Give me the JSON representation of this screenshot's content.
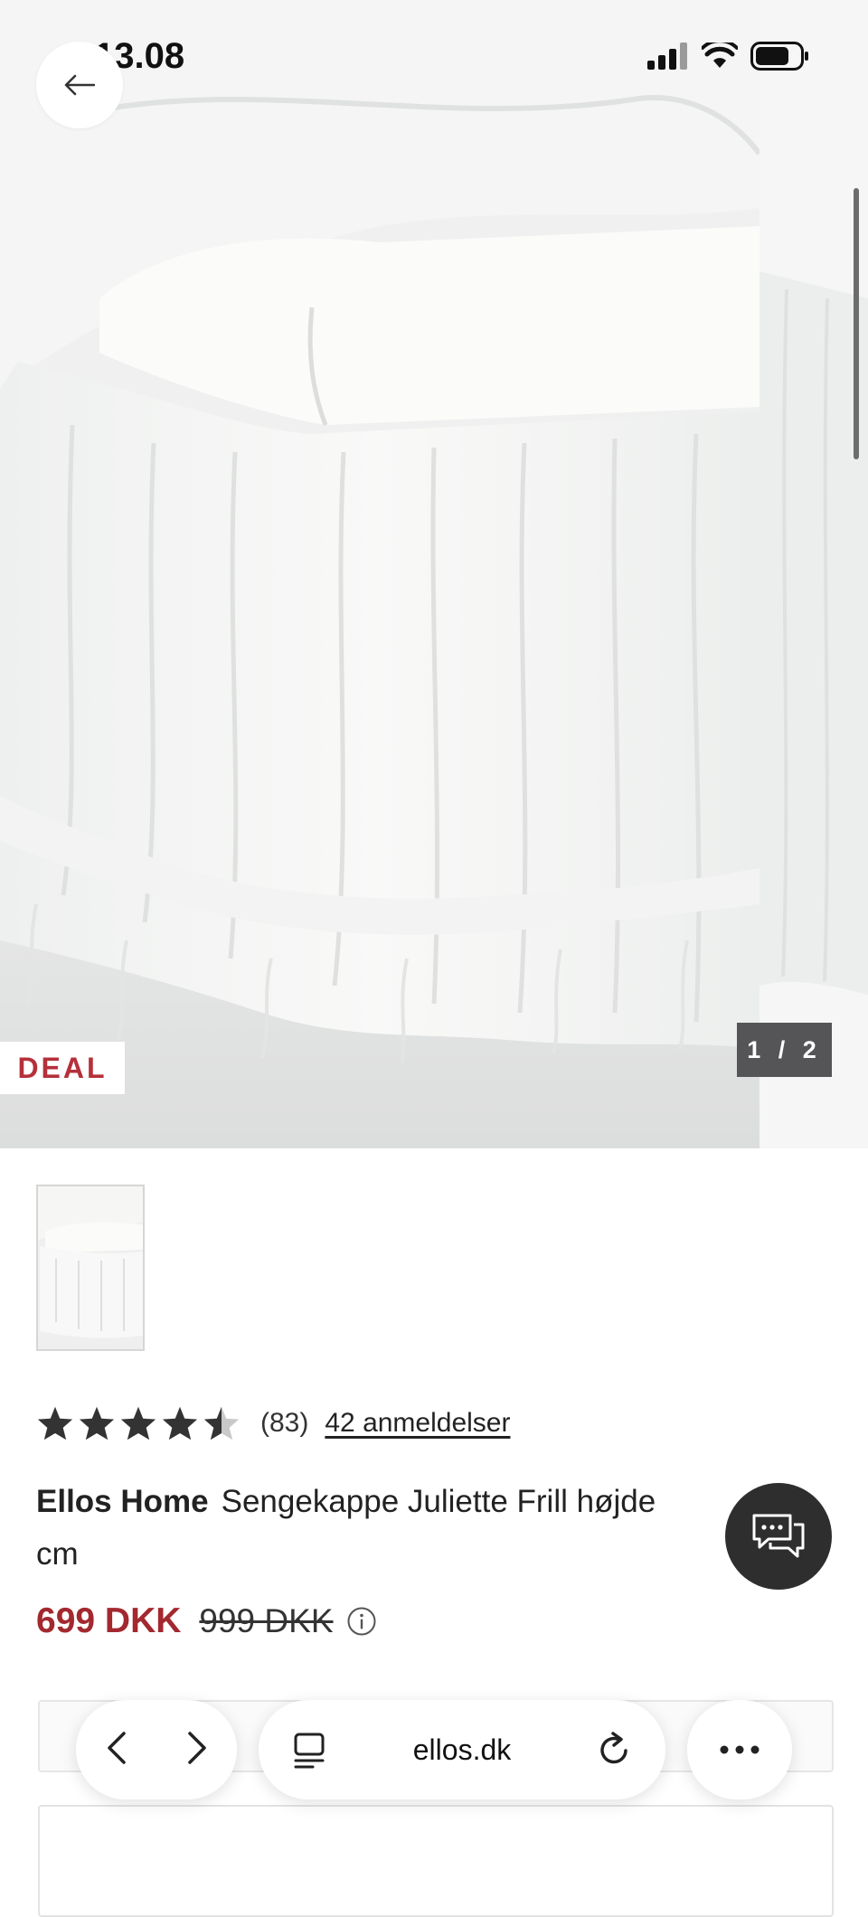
{
  "status_bar": {
    "time": "13.08"
  },
  "gallery": {
    "badge": "DEAL",
    "counter": "1 / 2"
  },
  "rating": {
    "stars": 4.5,
    "count": "(83)",
    "reviews_link": "42 anmeldelser"
  },
  "product": {
    "brand": "Ellos Home",
    "name": "Sengekappe Juliette Frill højde",
    "name_end": "cm"
  },
  "price": {
    "current": "699 DKK",
    "original": "999 DKK"
  },
  "browser": {
    "url": "ellos.dk"
  },
  "icons": {
    "back": "arrow-left-icon",
    "chat": "chat-bubbles-icon",
    "info": "info-icon",
    "prev": "chevron-left-icon",
    "next": "chevron-right-icon",
    "tabs": "tabs-icon",
    "reload": "reload-icon",
    "more": "more-icon"
  },
  "colors": {
    "price_accent": "#a3282f",
    "badge_text": "#b5303a",
    "chat_bg": "#2e2e2e"
  }
}
